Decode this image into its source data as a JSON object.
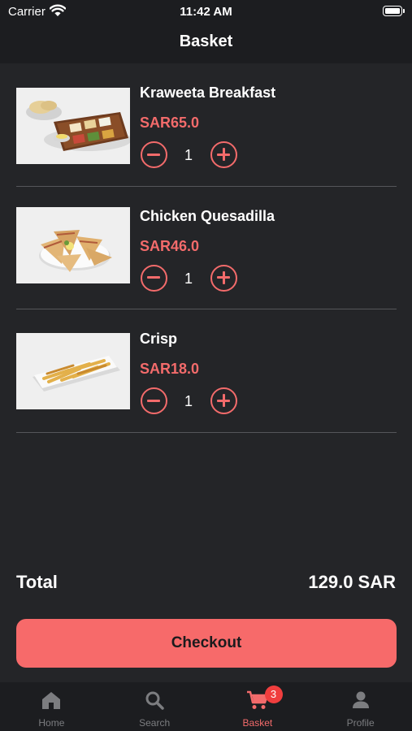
{
  "status_bar": {
    "carrier": "Carrier",
    "time": "11:42 AM"
  },
  "header": {
    "title": "Basket"
  },
  "items": [
    {
      "name": "Kraweeta Breakfast",
      "price": "SAR65.0",
      "quantity": "1",
      "image": "breakfast-platter"
    },
    {
      "name": "Chicken Quesadilla",
      "price": "SAR46.0",
      "quantity": "1",
      "image": "quesadilla-plate"
    },
    {
      "name": "Crisp",
      "price": "SAR18.0",
      "quantity": "1",
      "image": "fries-plate"
    }
  ],
  "summary": {
    "total_label": "Total",
    "total_value": "129.0 SAR"
  },
  "checkout": {
    "label": "Checkout"
  },
  "tab_bar": {
    "tabs": [
      {
        "label": "Home",
        "icon": "home-icon",
        "active": false
      },
      {
        "label": "Search",
        "icon": "search-icon",
        "active": false
      },
      {
        "label": "Basket",
        "icon": "cart-icon",
        "active": true,
        "badge": "3"
      },
      {
        "label": "Profile",
        "icon": "person-icon",
        "active": false
      }
    ]
  },
  "colors": {
    "background": "#242528",
    "bars": "#1c1d20",
    "accent": "#f36b6b",
    "checkout_button": "#f76a6a",
    "badge": "#f03e3e",
    "inactive_tab": "#7c7d80"
  }
}
